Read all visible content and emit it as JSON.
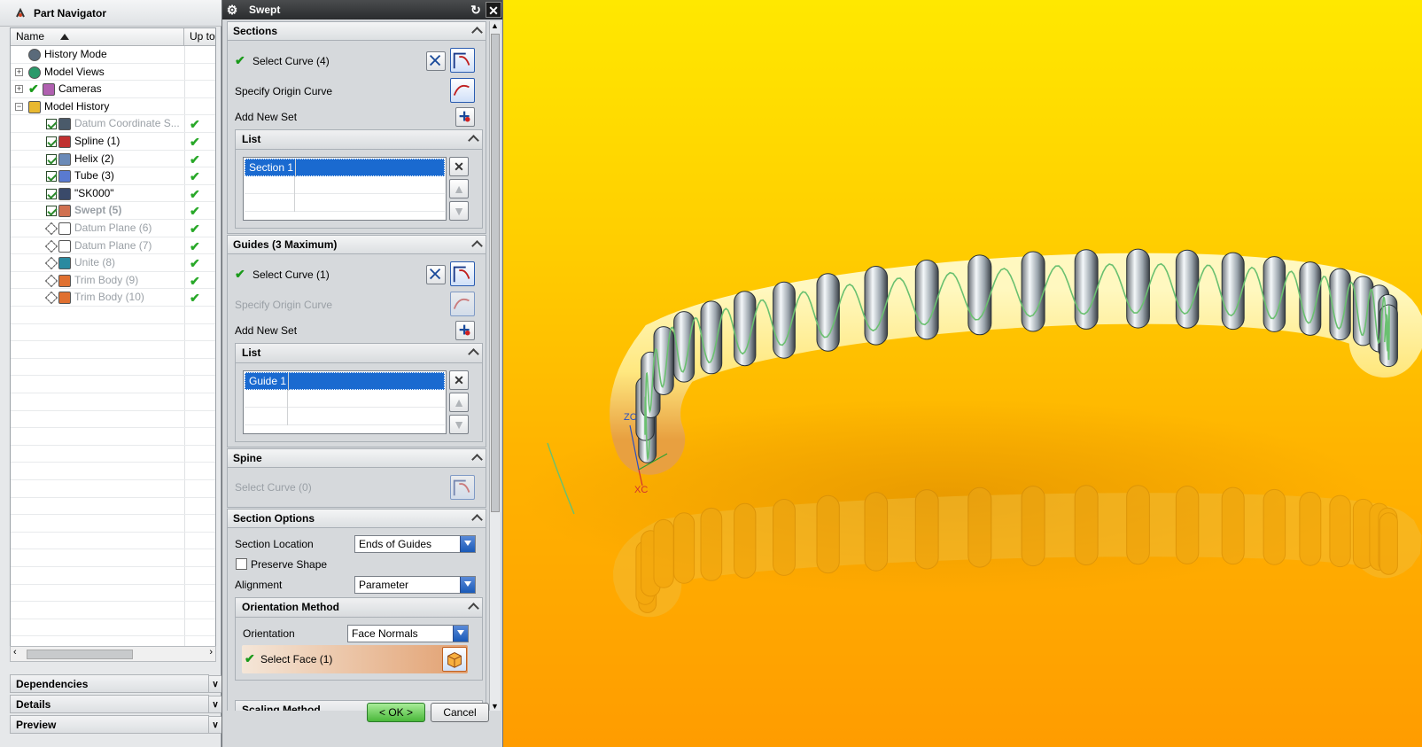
{
  "navigator": {
    "title": "Part Navigator",
    "columns": {
      "name": "Name",
      "up_to_date": "Up to"
    },
    "items": [
      {
        "label": "History Mode",
        "dim": false,
        "check": false
      },
      {
        "label": "Model Views",
        "dim": false,
        "check": false
      },
      {
        "label": "Cameras",
        "dim": false,
        "check": false
      },
      {
        "label": "Model History",
        "dim": false,
        "check": false
      },
      {
        "label": "Datum Coordinate S...",
        "dim": true,
        "check": true
      },
      {
        "label": "Spline (1)",
        "dim": false,
        "check": true
      },
      {
        "label": "Helix (2)",
        "dim": false,
        "check": true
      },
      {
        "label": "Tube (3)",
        "dim": false,
        "check": true
      },
      {
        "label": "\"SK000\"",
        "dim": false,
        "check": true
      },
      {
        "label": "Swept (5)",
        "dim": true,
        "check": true
      },
      {
        "label": "Datum Plane (6)",
        "dim": true,
        "check": true
      },
      {
        "label": "Datum Plane (7)",
        "dim": true,
        "check": true
      },
      {
        "label": "Unite (8)",
        "dim": true,
        "check": true
      },
      {
        "label": "Trim Body (9)",
        "dim": true,
        "check": true
      },
      {
        "label": "Trim Body (10)",
        "dim": true,
        "check": true
      }
    ],
    "check_glyph": "✔",
    "panels": {
      "dependencies": "Dependencies",
      "details": "Details",
      "preview": "Preview"
    }
  },
  "dialog": {
    "title": "Swept",
    "sections": {
      "title": "Sections",
      "select_curve": "Select Curve (4)",
      "specify_origin": "Specify Origin Curve",
      "add_new_set": "Add New Set",
      "list_title": "List",
      "list_item": "Section 1"
    },
    "guides": {
      "title": "Guides (3 Maximum)",
      "select_curve": "Select Curve (1)",
      "specify_origin": "Specify Origin Curve",
      "add_new_set": "Add New Set",
      "list_title": "List",
      "list_item": "Guide 1"
    },
    "spine": {
      "title": "Spine",
      "select_curve": "Select Curve (0)"
    },
    "section_options": {
      "title": "Section Options",
      "section_location_label": "Section Location",
      "section_location_value": "Ends of Guides",
      "preserve_shape": "Preserve Shape",
      "alignment_label": "Alignment",
      "alignment_value": "Parameter",
      "orientation_title": "Orientation Method",
      "orientation_label": "Orientation",
      "orientation_value": "Face Normals",
      "select_face": "Select Face (1)",
      "scaling_title": "Scaling Method"
    },
    "ok": "< OK >",
    "cancel": "Cancel"
  },
  "viewport": {
    "axis_zc": "ZC",
    "axis_xc": "XC",
    "colors": {
      "bg_top": "#ffe800",
      "bg_bottom": "#ff9c00",
      "tube": "#fff3a0",
      "ring": "#b8c4cc",
      "helix": "#6ac070"
    }
  }
}
